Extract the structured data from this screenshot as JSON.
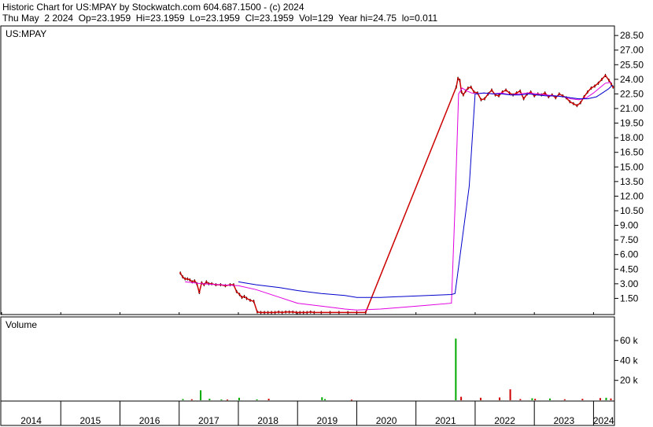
{
  "header": {
    "line1": "Historic Chart for US:MPAY by Stockwatch.com 604.687.1500 - (c) 2024",
    "line2": "Thu May  2 2024  Op=23.1959  Hi=23.1959  Lo=23.1959  Cl=23.1959  Vol=129  Year hi=24.75  lo=0.011"
  },
  "chart_data": [
    {
      "type": "line",
      "title": "US:MPAY",
      "y_ticks": [
        "28.50",
        "27.00",
        "25.50",
        "24.00",
        "22.50",
        "21.00",
        "19.50",
        "18.00",
        "16.50",
        "15.00",
        "13.50",
        "12.00",
        "10.50",
        "9.00",
        "7.50",
        "6.00",
        "4.50",
        "3.00",
        "1.50"
      ],
      "ylim": [
        0,
        29.4
      ],
      "x_ticks": [
        "2014",
        "2015",
        "2016",
        "2017",
        "2018",
        "2019",
        "2020",
        "2021",
        "2022",
        "2023",
        "2024"
      ],
      "xlim": [
        2014.0,
        2024.34
      ],
      "grid": false,
      "series": [
        {
          "color": "#cc0000",
          "x": [
            2017.02,
            2017.06,
            2017.1,
            2017.14,
            2017.18,
            2017.22,
            2017.26,
            2017.3,
            2017.34,
            2017.38,
            2017.42,
            2017.46,
            2017.5,
            2017.55,
            2017.62,
            2017.7,
            2017.78,
            2017.86,
            2017.92,
            2017.97,
            2018.02,
            2018.06,
            2018.1,
            2018.14,
            2018.2,
            2018.26,
            2018.32,
            2018.38,
            2018.44,
            2018.5,
            2018.56,
            2018.62,
            2018.68,
            2018.74,
            2018.8,
            2018.86,
            2018.92,
            2018.98,
            2019.04,
            2019.1,
            2019.16,
            2019.22,
            2019.28,
            2019.4,
            2019.55,
            2019.7,
            2019.85,
            2020.0,
            2020.15,
            2021.68,
            2021.71,
            2021.74,
            2021.77,
            2021.8,
            2021.84,
            2021.88,
            2021.93,
            2021.98,
            2022.04,
            2022.1,
            2022.16,
            2022.22,
            2022.28,
            2022.34,
            2022.4,
            2022.46,
            2022.52,
            2022.58,
            2022.64,
            2022.7,
            2022.76,
            2022.82,
            2022.88,
            2022.94,
            2023.0,
            2023.06,
            2023.12,
            2023.18,
            2023.24,
            2023.3,
            2023.36,
            2023.42,
            2023.48,
            2023.54,
            2023.6,
            2023.66,
            2023.72,
            2023.78,
            2023.84,
            2023.9,
            2023.96,
            2024.02,
            2024.08,
            2024.14,
            2024.2,
            2024.26,
            2024.3,
            2024.33
          ],
          "y": [
            4.1,
            3.7,
            3.5,
            3.5,
            3.4,
            3.2,
            3.3,
            3.0,
            2.1,
            3.1,
            2.9,
            3.2,
            3.0,
            3.0,
            2.9,
            2.9,
            2.8,
            2.9,
            2.9,
            2.2,
            1.9,
            1.6,
            1.7,
            1.5,
            1.3,
            1.2,
            0.1,
            0.05,
            0.05,
            0.05,
            0.05,
            0.05,
            0.1,
            0.05,
            0.1,
            0.1,
            0.1,
            0.05,
            0.05,
            0.05,
            0.05,
            0.1,
            0.05,
            0.05,
            0.05,
            0.05,
            0.05,
            0.05,
            0.05,
            23.2,
            24.1,
            23.9,
            22.7,
            22.4,
            22.8,
            23.1,
            23.2,
            22.7,
            22.6,
            21.9,
            22.0,
            22.5,
            22.9,
            22.4,
            22.3,
            22.7,
            22.9,
            22.6,
            22.4,
            22.6,
            22.8,
            22.0,
            22.5,
            22.7,
            22.3,
            22.5,
            22.4,
            22.6,
            22.2,
            22.4,
            22.1,
            22.5,
            22.3,
            22.1,
            21.7,
            21.5,
            21.3,
            21.6,
            22.2,
            22.7,
            23.1,
            23.3,
            23.6,
            24.0,
            24.4,
            23.9,
            23.5,
            23.2
          ]
        },
        {
          "color": "#e000e0",
          "x": [
            2017.1,
            2017.4,
            2017.7,
            2018.0,
            2018.3,
            2018.7,
            2019.0,
            2019.4,
            2019.8,
            2020.0,
            2020.4,
            2020.8,
            2021.2,
            2021.6,
            2021.66,
            2021.72,
            2021.78,
            2021.86,
            2021.94,
            2022.02,
            2022.15,
            2022.3,
            2022.45,
            2022.6,
            2022.75,
            2022.9,
            2023.05,
            2023.2,
            2023.35,
            2023.5,
            2023.62,
            2023.75,
            2023.88,
            2024.0,
            2024.1,
            2024.2,
            2024.3
          ],
          "y": [
            3.2,
            3.0,
            2.9,
            2.8,
            2.4,
            1.6,
            1.0,
            0.7,
            0.4,
            0.3,
            0.4,
            0.6,
            0.8,
            1.0,
            11.0,
            22.5,
            23.1,
            22.8,
            22.6,
            22.5,
            22.6,
            22.5,
            22.6,
            22.4,
            22.5,
            22.6,
            22.5,
            22.4,
            22.3,
            22.2,
            22.0,
            21.9,
            22.1,
            22.6,
            23.1,
            23.6,
            23.7
          ]
        },
        {
          "color": "#0000cc",
          "x": [
            2018.0,
            2018.3,
            2018.7,
            2019.0,
            2019.4,
            2019.8,
            2020.0,
            2020.4,
            2020.8,
            2021.2,
            2021.6,
            2021.66,
            2021.9,
            2022.0,
            2022.15,
            2022.3,
            2022.45,
            2022.6,
            2022.75,
            2022.9,
            2023.05,
            2023.2,
            2023.35,
            2023.5,
            2023.62,
            2023.75,
            2023.9,
            2024.05,
            2024.15,
            2024.25,
            2024.32
          ],
          "y": [
            3.2,
            2.9,
            2.6,
            2.3,
            2.0,
            1.8,
            1.6,
            1.6,
            1.7,
            1.8,
            1.9,
            2.0,
            13.0,
            22.5,
            22.6,
            22.5,
            22.5,
            22.4,
            22.4,
            22.5,
            22.4,
            22.3,
            22.3,
            22.2,
            22.1,
            22.0,
            22.0,
            22.2,
            22.6,
            23.0,
            23.4
          ]
        }
      ]
    },
    {
      "type": "bar",
      "title": "Volume",
      "y_ticks": [
        "60 k",
        "40 k",
        "20 k"
      ],
      "ylim": [
        0,
        83000
      ],
      "xlim": [
        2014.0,
        2024.34
      ],
      "series": [
        {
          "color": "#00aa00",
          "x": [
            2017.05,
            2017.35,
            2017.5,
            2017.7,
            2018.0,
            2018.3,
            2019.4,
            2019.45,
            2021.66,
            2022.95,
            2023.25,
            2024.2
          ],
          "values": [
            1200,
            10000,
            1500,
            800,
            2500,
            900,
            3000,
            1200,
            62000,
            2000,
            1800,
            2500
          ]
        },
        {
          "color": "#cc0000",
          "x": [
            2017.2,
            2017.8,
            2018.5,
            2019.9,
            2021.75,
            2022.08,
            2022.4,
            2022.58,
            2022.75,
            2023.0,
            2023.5,
            2023.8,
            2024.1,
            2024.28
          ],
          "values": [
            1000,
            700,
            1500,
            600,
            3500,
            2500,
            2800,
            11000,
            1200,
            1500,
            1000,
            1400,
            2200,
            1800
          ]
        }
      ]
    }
  ]
}
